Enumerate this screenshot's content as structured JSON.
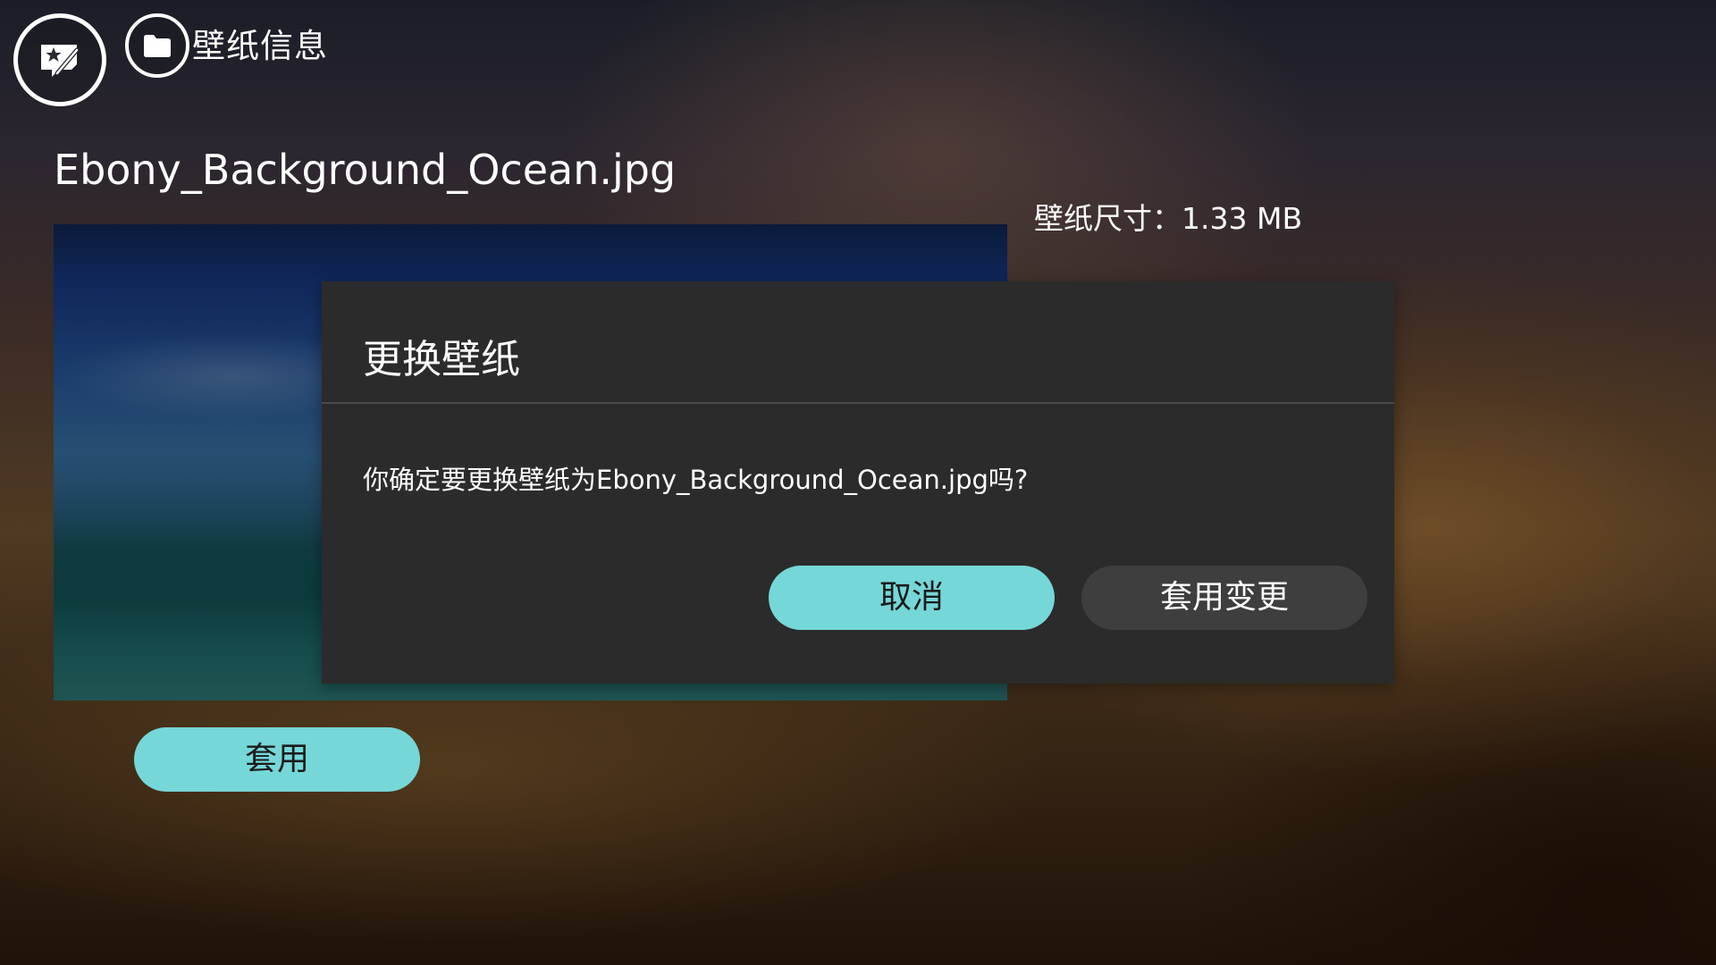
{
  "header": {
    "logo_icon": "wallpaper-star-brush-icon",
    "folder_icon": "folder-icon",
    "title": "壁纸信息"
  },
  "wallpaper": {
    "file_name": "Ebony_Background_Ocean.jpg",
    "size_label": "壁纸尺寸：1.33 MB",
    "apply_label": "套用"
  },
  "dialog": {
    "title": "更换壁纸",
    "message": "你确定要更换壁纸为Ebony_Background_Ocean.jpg吗?",
    "cancel_label": "取消",
    "confirm_label": "套用变更"
  },
  "colors": {
    "accent": "#76d7d8",
    "dialog_bg": "#2b2b2b",
    "secondary_button": "#3e3e3e"
  }
}
